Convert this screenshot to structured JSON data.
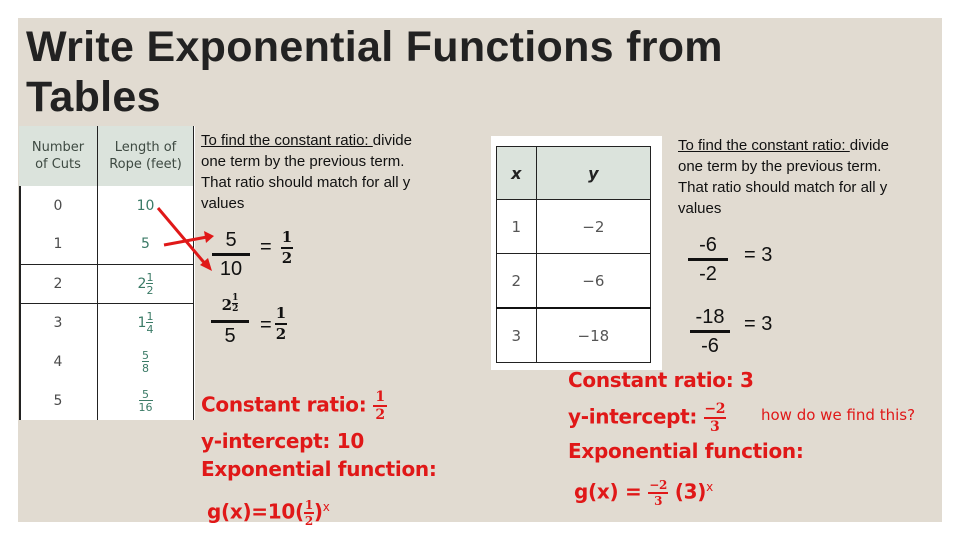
{
  "slide": {
    "title_line1": "Write Exponential Functions from",
    "title_line2": "Tables",
    "background_color": "#e1dbd1",
    "accent_red": "#e01818"
  },
  "left_example": {
    "table": {
      "headers": [
        "Number of Cuts",
        "Length of Rope (feet)"
      ],
      "header_lines": [
        [
          "Number",
          "of Cuts"
        ],
        [
          "Length of",
          "Rope (feet)"
        ]
      ],
      "rows": [
        {
          "x": "0",
          "y": "10"
        },
        {
          "x": "1",
          "y": "5"
        },
        {
          "x": "2",
          "y_whole": "2",
          "y_num": "1",
          "y_den": "2",
          "y": "2 1/2"
        },
        {
          "x": "3",
          "y_whole": "1",
          "y_num": "1",
          "y_den": "4",
          "y": "1 1/4"
        },
        {
          "x": "4",
          "y_num": "5",
          "y_den": "8",
          "y": "5/8"
        },
        {
          "x": "5",
          "y_num": "5",
          "y_den": "16",
          "y": "5/16"
        }
      ]
    },
    "instruction_underlined": "To find the constant ratio: ",
    "instruction_rest_line1": "divide",
    "instruction_line2": "one term by the previous term.",
    "instruction_line3": "That ratio should match for all y",
    "instruction_line4": "values",
    "ratio1": {
      "num": "5",
      "den": "10",
      "eq": "=",
      "res_num": "1",
      "res_den": "2"
    },
    "ratio2": {
      "num_whole": "2",
      "num_num": "1",
      "num_den": "2",
      "den": "5",
      "eq": "=",
      "res_num": "1",
      "res_den": "2"
    },
    "summary": {
      "constant_ratio_label": "Constant ratio: ",
      "constant_ratio_num": "1",
      "constant_ratio_den": "2",
      "y_intercept": "y-intercept: 10",
      "function_label": "Exponential function:",
      "function_prefix": "g(x)=10(",
      "function_num": "1",
      "function_den": "2",
      "function_suffix": ")",
      "function_exp": "x"
    }
  },
  "right_example": {
    "table": {
      "headers": [
        "x",
        "y"
      ],
      "rows": [
        {
          "x": "1",
          "y": "−2"
        },
        {
          "x": "2",
          "y": "−6"
        },
        {
          "x": "3",
          "y": "−18"
        }
      ]
    },
    "instruction_underlined": "To find the constant ratio: ",
    "instruction_rest_line1": "divide",
    "instruction_line2": "one term by the previous term.",
    "instruction_line3": "That ratio should match for all y",
    "instruction_line4": "values",
    "ratio1": {
      "num": "-6",
      "den": "-2",
      "result": "= 3"
    },
    "ratio2": {
      "num": "-18",
      "den": "-6",
      "result": "= 3"
    },
    "summary": {
      "constant_ratio": "Constant ratio: 3",
      "y_intercept_label": "y-intercept: ",
      "y_intercept_num": "−2",
      "y_intercept_den": "3",
      "hint": "how do we find this?",
      "function_label": "Exponential function:",
      "function_prefix": "g(x) = ",
      "function_num": "−2",
      "function_den": "3",
      "function_suffix": " (3)",
      "function_exp": "x"
    }
  }
}
